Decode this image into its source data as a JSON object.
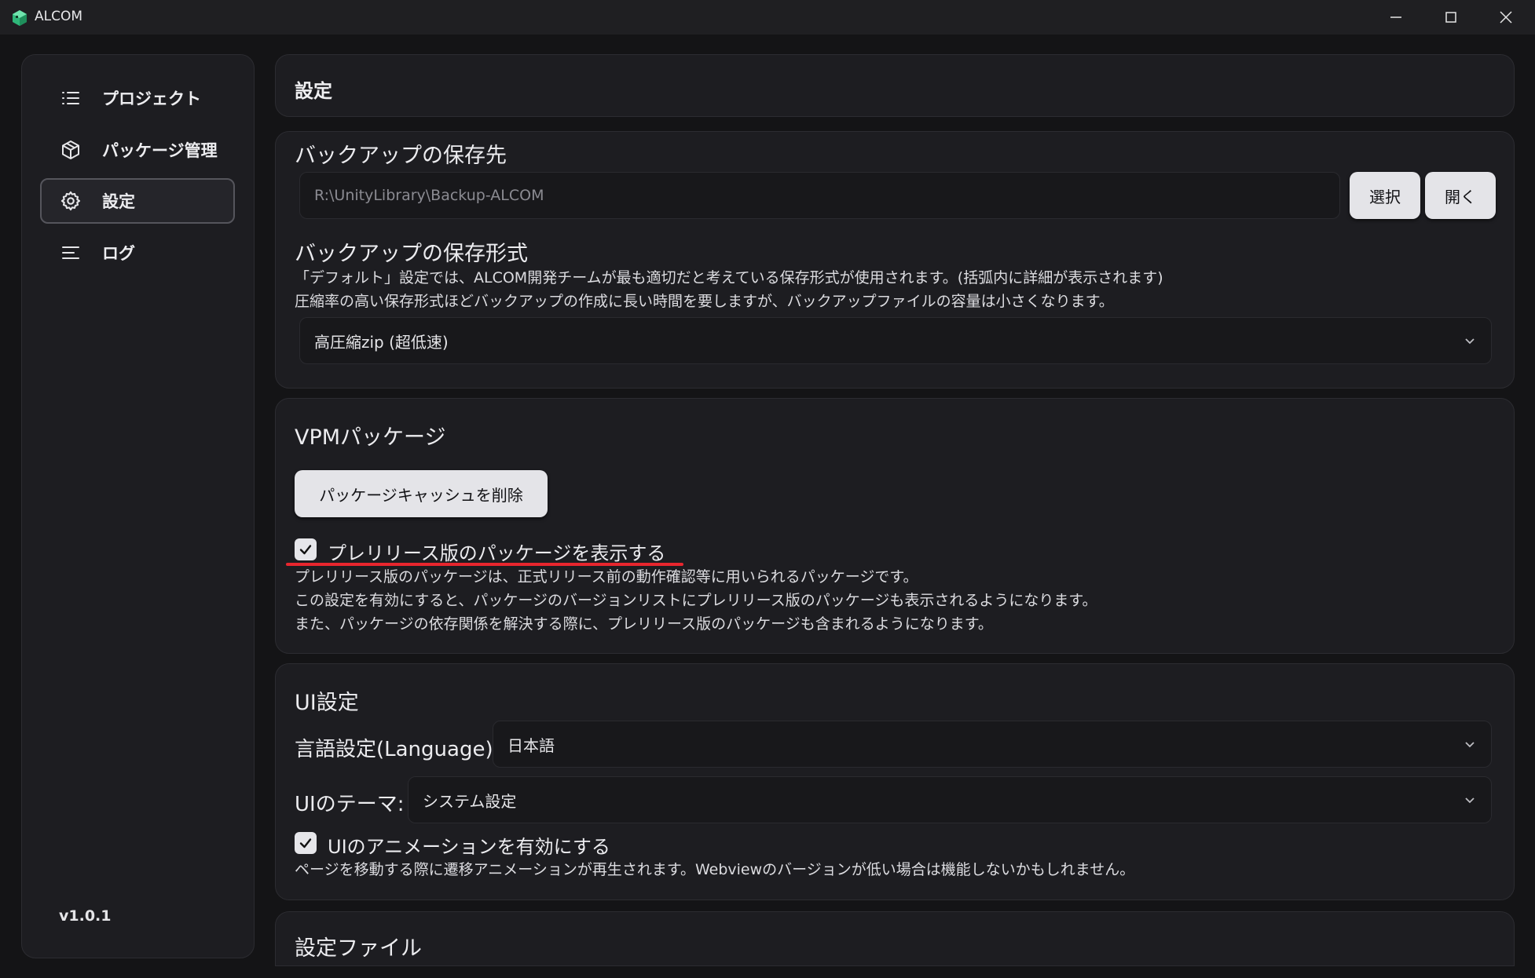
{
  "window": {
    "title": "ALCOM",
    "accent": "#3fcf8e"
  },
  "sidebar": {
    "items": [
      {
        "label": "プロジェクト",
        "icon": "list-icon"
      },
      {
        "label": "パッケージ管理",
        "icon": "package-icon"
      },
      {
        "label": "設定",
        "icon": "gear-icon",
        "active": true
      },
      {
        "label": "ログ",
        "icon": "log-lines-icon"
      }
    ],
    "version": "v1.0.1"
  },
  "header": {
    "title": "設定"
  },
  "backup": {
    "location_title": "バックアップの保存先",
    "path_placeholder": "R:\\UnityLibrary\\Backup-ALCOM",
    "select_button": "選択",
    "open_button": "開く",
    "format_title": "バックアップの保存形式",
    "format_desc_1": "「デフォルト」設定では、ALCOM開発チームが最も適切だと考えている保存形式が使用されます。(括弧内に詳細が表示されます)",
    "format_desc_2": "圧縮率の高い保存形式ほどバックアップの作成に長い時間を要しますが、バックアップファイルの容量は小さくなります。",
    "format_value": "高圧縮zip (超低速)"
  },
  "vpm": {
    "title": "VPMパッケージ",
    "clear_cache_button": "パッケージキャッシュを削除",
    "prerelease_checked": true,
    "prerelease_label": "プレリリース版のパッケージを表示する",
    "prerelease_desc_1": "プレリリース版のパッケージは、正式リリース前の動作確認等に用いられるパッケージです。",
    "prerelease_desc_2": "この設定を有効にすると、パッケージのバージョンリストにプレリリース版のパッケージも表示されるようになります。",
    "prerelease_desc_3": "また、パッケージの依存関係を解決する際に、プレリリース版のパッケージも含まれるようになります。",
    "highlight_color": "#e8262e"
  },
  "ui": {
    "title": "UI設定",
    "language_label": "言語設定(Language):",
    "language_value": "日本語",
    "theme_label": "UIのテーマ:",
    "theme_value": "システム設定",
    "animation_checked": true,
    "animation_label": "UIのアニメーションを有効にする",
    "animation_desc": "ページを移動する際に遷移アニメーションが再生されます。Webviewのバージョンが低い場合は機能しないかもしれません。"
  },
  "settings_file": {
    "title": "設定ファイル"
  }
}
